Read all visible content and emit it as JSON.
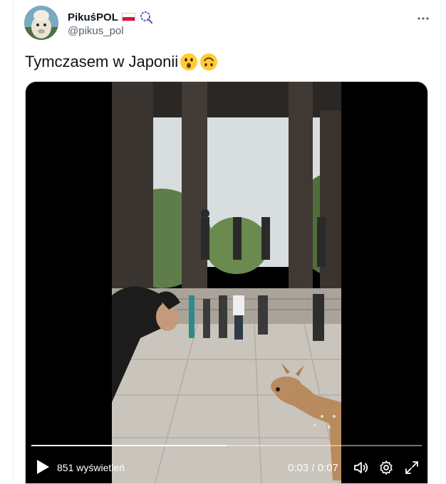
{
  "author": {
    "display_name": "PikuśPOL",
    "handle": "@pikus_pol"
  },
  "tweet": {
    "text": "Tymczasem w Japonii"
  },
  "video": {
    "views_label": "851 wyświetleń",
    "time_label": "0:03 / 0:07",
    "progress_fraction": 0.5
  },
  "icons": {
    "more": "more-horizontal-icon",
    "play": "play-icon",
    "volume": "volume-icon",
    "settings": "gear-icon",
    "fullscreen": "fullscreen-icon"
  },
  "colors": {
    "text_primary": "#0f1419",
    "text_secondary": "#536471",
    "verified_purple": "#6b4fbb"
  }
}
